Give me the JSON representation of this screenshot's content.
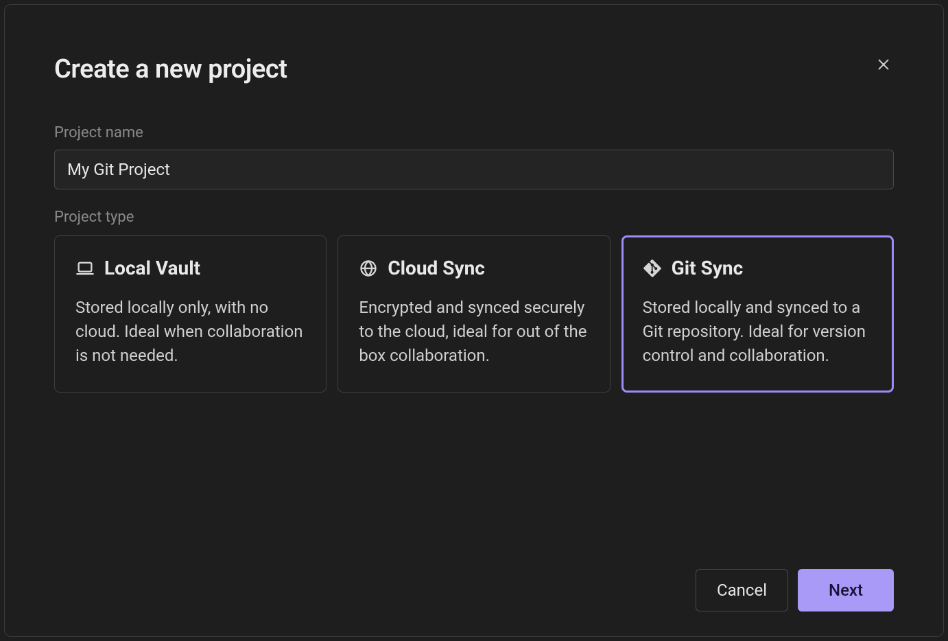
{
  "dialog": {
    "title": "Create a new project"
  },
  "fields": {
    "name_label": "Project name",
    "name_value": "My Git Project",
    "type_label": "Project type"
  },
  "options": {
    "local": {
      "title": "Local Vault",
      "desc": "Stored locally only, with no cloud. Ideal when collaboration is not needed."
    },
    "cloud": {
      "title": "Cloud Sync",
      "desc": "Encrypted and synced securely to the cloud, ideal for out of the box collaboration."
    },
    "git": {
      "title": "Git Sync",
      "desc": "Stored locally and synced to a Git repository. Ideal for version control and collaboration."
    }
  },
  "buttons": {
    "cancel": "Cancel",
    "next": "Next"
  },
  "colors": {
    "accent": "#9b8cf7",
    "primary_btn": "#a99af8"
  }
}
